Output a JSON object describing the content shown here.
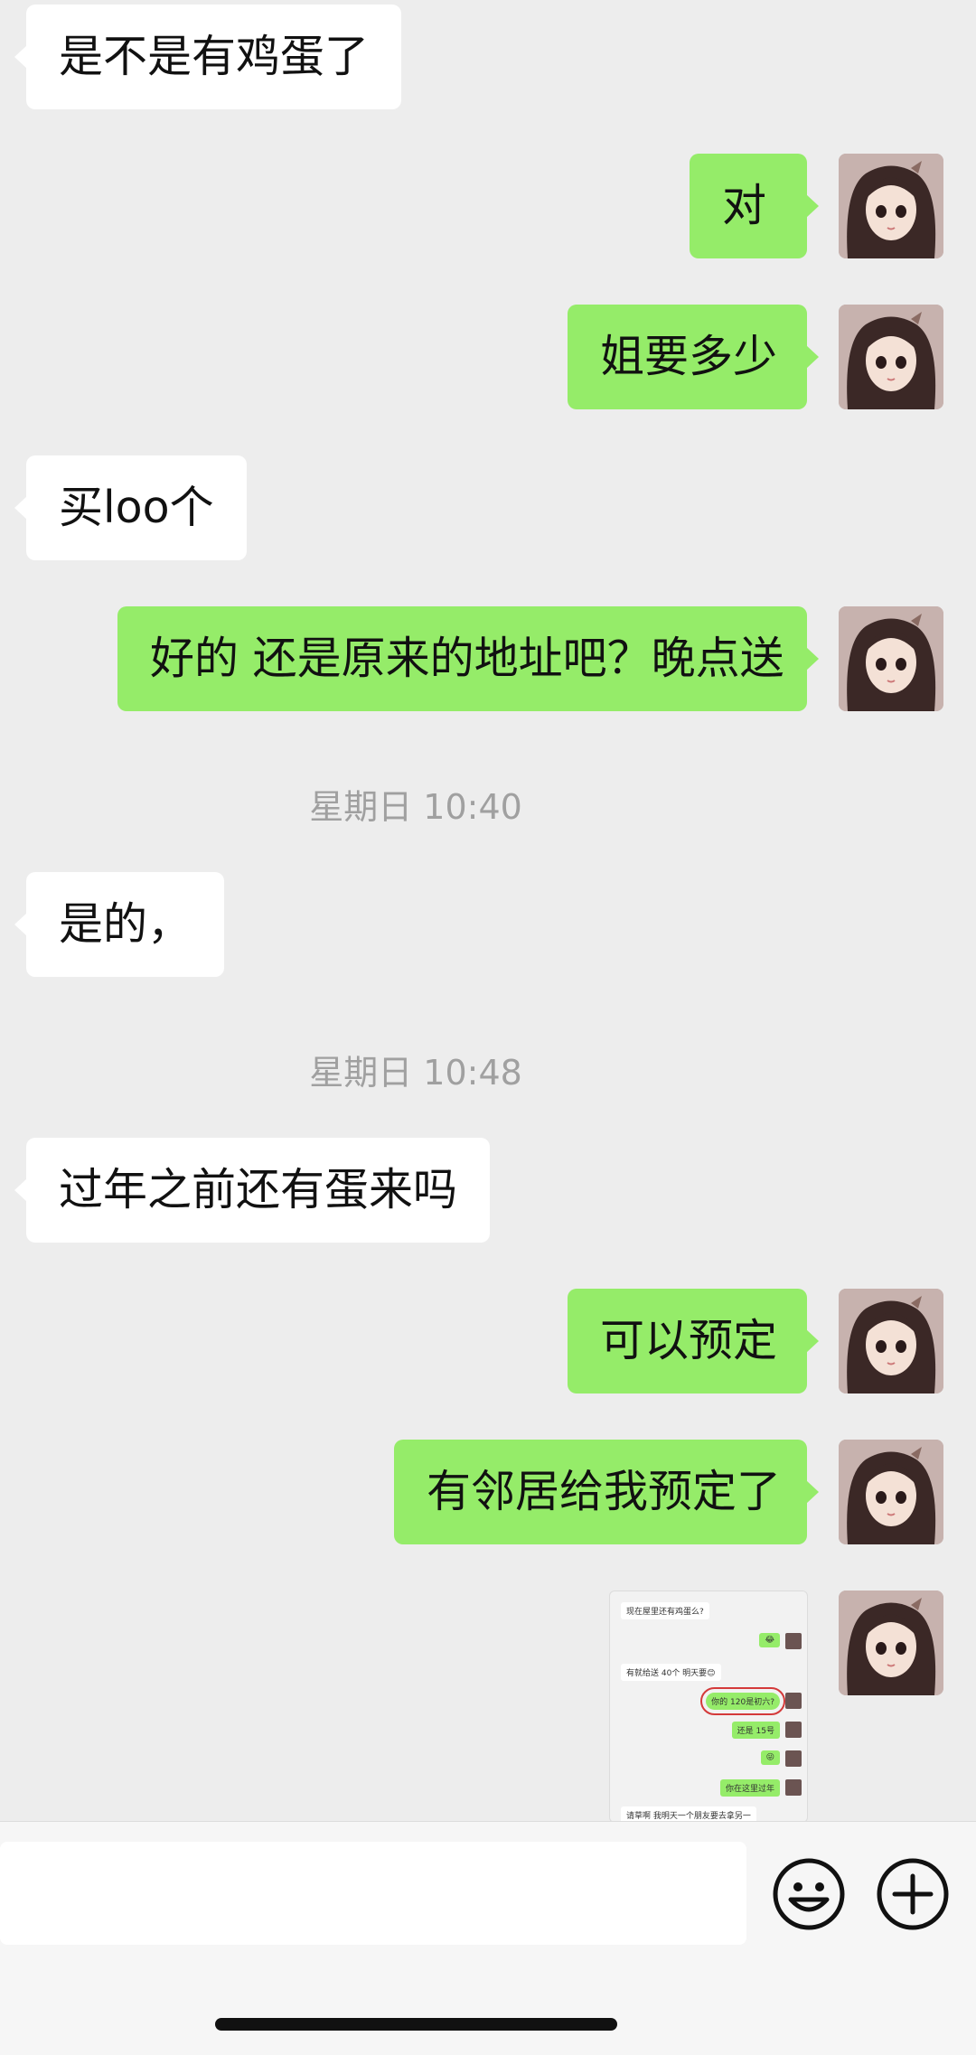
{
  "messages": [
    {
      "text": "是不是有鸡蛋了"
    },
    {
      "text": "对"
    },
    {
      "text": "姐要多少"
    },
    {
      "text": "买loo个"
    },
    {
      "text": "好的 还是原来的地址吧？晚点送"
    },
    {
      "text": "是的，"
    },
    {
      "text": "过年之前还有蛋来吗"
    },
    {
      "text": "可以预定"
    },
    {
      "text": "有邻居给我预定了"
    }
  ],
  "timestamps": [
    "星期日 10:40",
    "星期日 10:48"
  ],
  "thumbnail": {
    "lines": [
      "现在屋里还有鸡蛋么?",
      "😂",
      "有就给送 40个 明天要😊",
      "你的 120是初六?",
      "还是 15号",
      "😜",
      "你在这里过年",
      "请草啊 我明天一个朋友要去拿另一"
    ]
  },
  "colors": {
    "background": "#ededed",
    "outgoing": "#95ec69",
    "incoming": "#ffffff"
  },
  "icons": {
    "emoji": "smiley-icon",
    "more": "plus-circle-icon"
  }
}
